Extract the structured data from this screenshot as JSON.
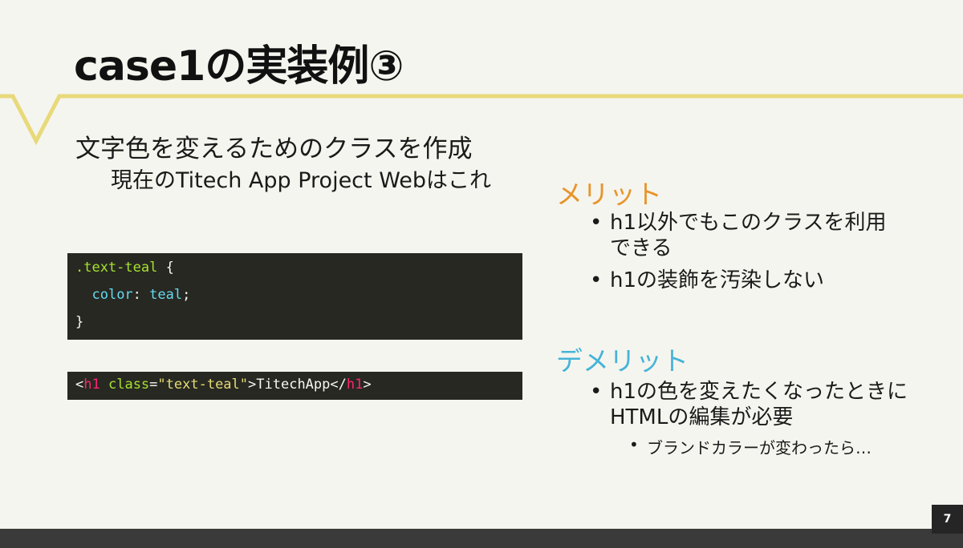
{
  "slide": {
    "title": "case1の実装例③",
    "subtitle": "文字色を変えるためのクラスを作成",
    "subtitle_sub": "現在のTitech App Project Webはこれ",
    "page_number": "7",
    "accent_color": "#e8d97a"
  },
  "code_css": {
    "line1_selector": ".text-teal",
    "line1_brace": " {",
    "line2_indent": "  ",
    "line2_property": "color",
    "line2_colon": ": ",
    "line2_value": "teal",
    "line2_semicolon": ";",
    "line3_brace": "}"
  },
  "code_html": {
    "open_bracket": "<",
    "tag": "h1",
    "space": " ",
    "attr": "class",
    "equals": "=",
    "attr_value": "\"text-teal\"",
    "close_bracket": ">",
    "content": "TitechApp",
    "end_open": "</",
    "end_tag": "h1",
    "end_close": ">"
  },
  "merit": {
    "heading": "メリット",
    "heading_color": "#e8942a",
    "items": [
      {
        "text": "h1以外でもこのクラスを利用\nできる"
      },
      {
        "text": "h1の装飾を汚染しない"
      }
    ]
  },
  "demerit": {
    "heading": "デメリット",
    "heading_color": "#46b4d8",
    "items": [
      {
        "text": "h1の色を変えたくなったときに\nHTMLの編集が必要"
      }
    ],
    "subitems": [
      {
        "text": "ブランドカラーが変わったら…"
      }
    ]
  },
  "bullet_char": "•"
}
